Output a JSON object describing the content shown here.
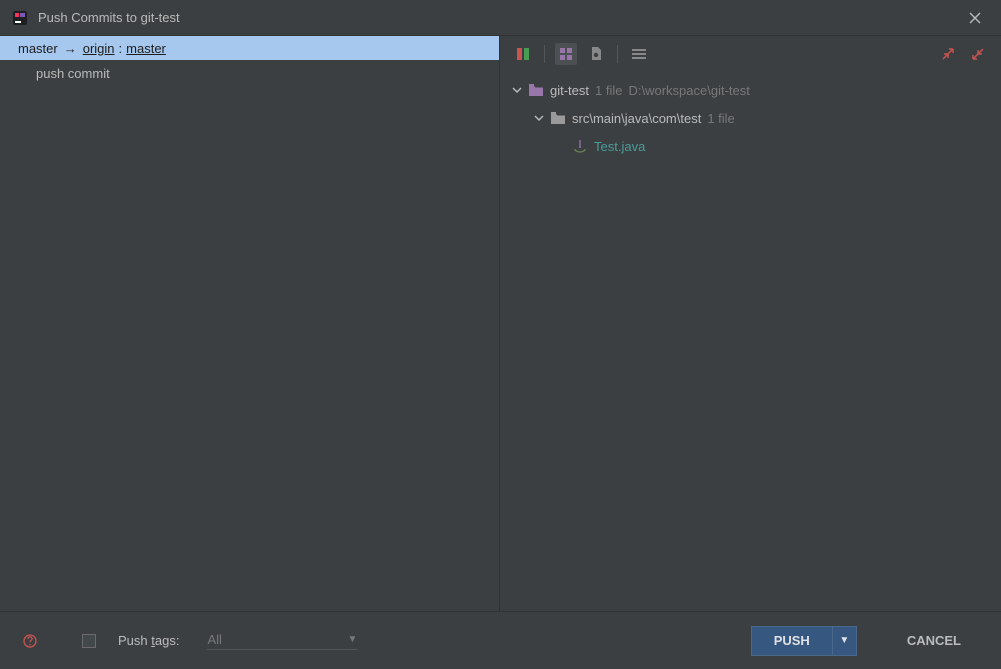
{
  "window": {
    "title": "Push Commits to git-test"
  },
  "left": {
    "branch": {
      "local": "master",
      "arrow": "→",
      "remote": "origin",
      "colon": ":",
      "remote_branch": "master"
    },
    "commits": [
      "push commit"
    ]
  },
  "tree": {
    "root": {
      "name": "git-test",
      "count": "1 file",
      "path": "D:\\workspace\\git-test"
    },
    "folder": {
      "name": "src\\main\\java\\com\\test",
      "count": "1 file"
    },
    "file": {
      "name": "Test.java"
    }
  },
  "footer": {
    "push_tags_label_prefix": "Push ",
    "push_tags_label_underlined": "t",
    "push_tags_label_suffix": "ags:",
    "push_tags_value": "All",
    "push_label": "PUSH",
    "cancel_label": "CANCEL"
  }
}
